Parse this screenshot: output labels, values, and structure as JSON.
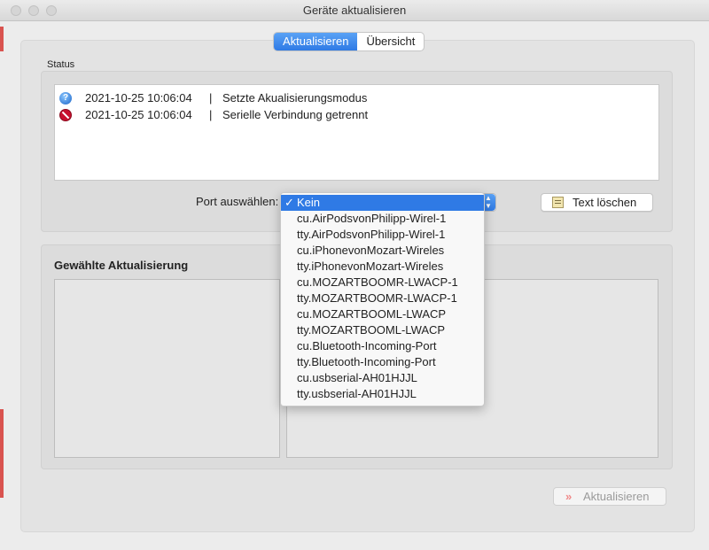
{
  "window": {
    "title": "Geräte aktualisieren"
  },
  "tabs": [
    {
      "label": "Aktualisieren",
      "active": true
    },
    {
      "label": "Übersicht",
      "active": false
    }
  ],
  "status": {
    "label": "Status",
    "log": [
      {
        "icon": "question-icon",
        "timestamp": "2021-10-25 10:06:04",
        "separator": "|",
        "message": "Setzte Akualisierungsmodus"
      },
      {
        "icon": "stop-icon",
        "timestamp": "2021-10-25 10:06:04",
        "separator": "|",
        "message": "Serielle Verbindung getrennt"
      }
    ]
  },
  "port": {
    "label": "Port auswählen:",
    "selected": "Kein",
    "options": [
      "Kein",
      "cu.AirPodsvonPhilipp-Wirel-1",
      "tty.AirPodsvonPhilipp-Wirel-1",
      "cu.iPhonevonMozart-Wireles",
      "tty.iPhonevonMozart-Wireles",
      "cu.MOZARTBOOMR-LWACP-1",
      "tty.MOZARTBOOMR-LWACP-1",
      "cu.MOZARTBOOML-LWACP",
      "tty.MOZARTBOOML-LWACP",
      "cu.Bluetooth-Incoming-Port",
      "tty.Bluetooth-Incoming-Port",
      "cu.usbserial-AH01HJJL",
      "tty.usbserial-AH01HJJL"
    ],
    "check_mark": "✓"
  },
  "clear_button": {
    "label": "Text löschen"
  },
  "update_section": {
    "title": "Gewählte Aktualisierung"
  },
  "action_button": {
    "label": "Aktualisieren",
    "enabled": false,
    "chevron": "»"
  },
  "colors": {
    "accent": "#2f7ae5",
    "selection_text": "#ffffff",
    "disabled_text": "#9a9a9a"
  }
}
